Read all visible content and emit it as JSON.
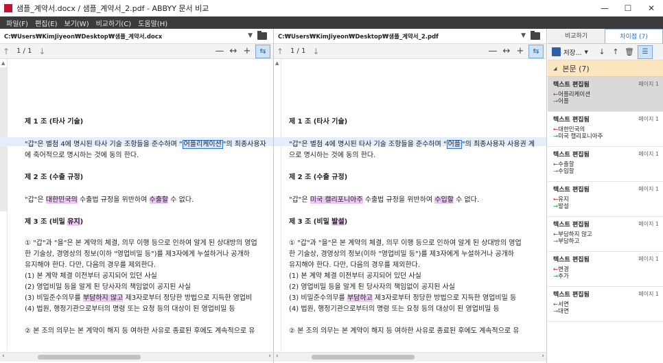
{
  "window": {
    "title": "샘플_계약서.docx / 샘플_계약서_2.pdf - ABBYY 문서 비교",
    "controls": [
      "minimize-icon",
      "maximize-icon",
      "close-icon"
    ]
  },
  "menu": [
    "파일(F)",
    "편집(E)",
    "보기(W)",
    "비교하기(C)",
    "도움말(H)"
  ],
  "left_pane": {
    "path": "C:₩Users₩KimJiyeon₩Desktop₩샘플_계약서.docx",
    "page_indicator": "1 / 1",
    "lines": [
      {
        "t": "제 1 조 (타사 기술)",
        "h": true
      },
      {
        "parts": [
          {
            "t": "\"갑\"은 별첨 4에 명시된 타사 기술 조항들을 준수하며 \""
          },
          {
            "t": "어플리케이션",
            "c": "boxed"
          },
          {
            "t": "\"의 최종사용자"
          }
        ],
        "rowhl": true
      },
      {
        "t": "에 축어적으로 명시하는 것에 동의 한다."
      },
      {
        "t": "제 2 조 (수출 규정)",
        "h": true
      },
      {
        "parts": [
          {
            "t": "\"갑\"은 "
          },
          {
            "t": "대한민국의",
            "c": "chg"
          },
          {
            "t": " 수출법 규정을 위반하여 "
          },
          {
            "t": "수출할",
            "c": "chg"
          },
          {
            "t": " 수 없다."
          }
        ]
      },
      {
        "parts": [
          {
            "t": "제 3 조 (비밀 ",
            "h": true
          },
          {
            "t": "유지",
            "c": "chg",
            "h": true
          },
          {
            "t": ")",
            "h": true
          }
        ]
      },
      {
        "t": "①  \"갑\"과 \"을\"은 본 계약의 체결, 의무 이행 등으로 인하여 알게 된 상대방의 영업"
      },
      {
        "t": "    한 기술상, 경영상의 정보(이하 \"영업비밀 등\")를 제3자에게 누설하거나 공개하"
      },
      {
        "t": "    유지해야 한다. 다만, 다음의 경우를 제외한다."
      },
      {
        "t": "    (1)  본 계약 체결 이전부터 공지되어 있던 사실"
      },
      {
        "t": "    (2)  영업비밀 등을 알게 된 당사자의 책임없이 공지된 사실"
      },
      {
        "parts": [
          {
            "t": "    (3)  비밀준수의무를 "
          },
          {
            "t": "부담하지 않고",
            "c": "chg"
          },
          {
            "t": " 제3자로부터 정당한 방법으로 지득한 영업비"
          }
        ]
      },
      {
        "t": "    (4)  법원, 행정기관으로부터의 명령 또는 요청 등의 대상이 된 영업비밀 등"
      },
      {
        "t": "②  본 조의 의무는 본 계약이 해지 등 여하한 사유로 종료된 후에도 계속적으로 유"
      }
    ]
  },
  "right_pane": {
    "path": "C:₩Users₩KimJiyeon₩Desktop₩샘플_계약서_2.pdf",
    "page_indicator": "1 / 1",
    "lines": [
      {
        "t": "제 1 조 (타사 기술)",
        "h": true
      },
      {
        "parts": [
          {
            "t": "\"갑\"은 별첨 4에 명시된 타사 기술 조항들을 준수하며 \""
          },
          {
            "t": "어플",
            "c": "boxed"
          },
          {
            "t": "\"의 최종사용자 사용권 계"
          }
        ],
        "rowhl": true
      },
      {
        "t": "으로 명시하는 것에 동의 한다."
      },
      {
        "t": "제 2 조 (수출 규정)",
        "h": true
      },
      {
        "parts": [
          {
            "t": "\"갑\"은 "
          },
          {
            "t": "미국 캘리포니아주",
            "c": "chg"
          },
          {
            "t": " 수출법 규정을 위반하여 "
          },
          {
            "t": "수입할",
            "c": "chg"
          },
          {
            "t": " 수 없다."
          }
        ]
      },
      {
        "parts": [
          {
            "t": "제 3 조 (비밀 ",
            "h": true
          },
          {
            "t": "발설",
            "c": "chg",
            "h": true
          },
          {
            "t": ")",
            "h": true
          }
        ]
      },
      {
        "t": "①  \"갑\"과 \"을\"은 본 계약의 체결, 의무 이행 등으로 인하여 알게 된 상대방의 영업"
      },
      {
        "t": "    한 기술상, 경영상의 정보(이하 \"영업비밀 등\")를 제3자에게 누설하거나 공개하"
      },
      {
        "t": "    유지해야 한다. 다만, 다음의 경우를 제외한다."
      },
      {
        "t": "    (1)  본 계약 체결 이전부터 공지되어 있던 사실"
      },
      {
        "t": "    (2)  영업비밀 등을 알게 된 당사자의 책임없이 공지된 사실"
      },
      {
        "parts": [
          {
            "t": "    (3)  비밀준수의무를 "
          },
          {
            "t": "부담하고",
            "c": "chg"
          },
          {
            "t": " 제3자로부터 정당한 방법으로 지득한 영업비밀 등"
          }
        ]
      },
      {
        "t": "    (4)  법원, 행정기관으로부터의 명령 또는 요청 등의 대상이 된 영업비밀 등"
      },
      {
        "t": "②  본 조의 의무는 본 계약이 해지 등 여하한 사유로 종료된 후에도 계속적으로 유"
      }
    ]
  },
  "side_panel": {
    "tabs": [
      "비교하기",
      "차이점 (7)"
    ],
    "save_label": "저장...",
    "section_label": "본문 (7)",
    "items": [
      {
        "type": "텍스트 편집됨",
        "page": "페이지 1",
        "old": "어플리케이션",
        "new": "어플"
      },
      {
        "type": "텍스트 편집됨",
        "page": "페이지 1",
        "old": "대한민국의",
        "new": "미국 캘리포니아주"
      },
      {
        "type": "텍스트 편집됨",
        "page": "페이지 1",
        "old": "수출할",
        "new": "수입할"
      },
      {
        "type": "텍스트 편집됨",
        "page": "페이지 1",
        "old": "유지",
        "new": "발설"
      },
      {
        "type": "텍스트 편집됨",
        "page": "페이지 1",
        "old": "부담하지 않고",
        "new": "부담하고"
      },
      {
        "type": "텍스트 편집됨",
        "page": "페이지 1",
        "old": "변경",
        "new": "추가"
      },
      {
        "type": "텍스트 편집됨",
        "page": "페이지 1",
        "old": "서면",
        "new": "대면"
      }
    ]
  },
  "colors": {
    "change_highlight": "#ecc8f5",
    "current_box": "#2f6fcc",
    "section_header": "#fce6c0",
    "removed_arrow": "#d21d1d",
    "added_arrow": "#1e9a3a"
  }
}
